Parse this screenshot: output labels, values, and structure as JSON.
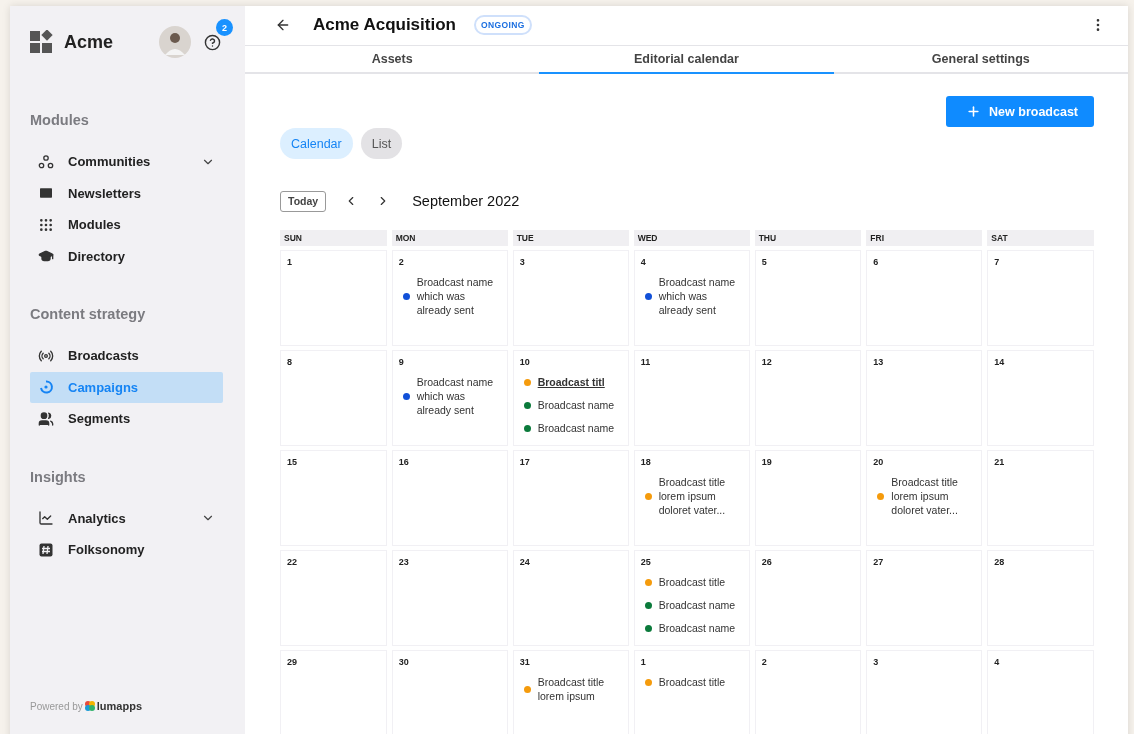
{
  "sidebar": {
    "brand": "Acme",
    "help_badge": "2",
    "sections": [
      {
        "title": "Modules",
        "items": [
          {
            "label": "Communities",
            "expandable": true,
            "selected": false
          },
          {
            "label": "Newsletters",
            "expandable": false,
            "selected": false
          },
          {
            "label": "Modules",
            "expandable": false,
            "selected": false
          },
          {
            "label": "Directory",
            "expandable": false,
            "selected": false
          }
        ]
      },
      {
        "title": "Content strategy",
        "items": [
          {
            "label": "Broadcasts",
            "expandable": false,
            "selected": false
          },
          {
            "label": "Campaigns",
            "expandable": false,
            "selected": true
          },
          {
            "label": "Segments",
            "expandable": false,
            "selected": false
          }
        ]
      },
      {
        "title": "Insights",
        "items": [
          {
            "label": "Analytics",
            "expandable": true,
            "selected": false
          },
          {
            "label": "Folksonomy",
            "expandable": false,
            "selected": false
          }
        ]
      }
    ],
    "powered_by": "Powered by",
    "powered_logo": "lumapps"
  },
  "header": {
    "title": "Acme Acquisition",
    "status": "ONGOING"
  },
  "tabs": [
    {
      "label": "Assets",
      "selected": false
    },
    {
      "label": "Editorial calendar",
      "selected": true
    },
    {
      "label": "General settings",
      "selected": false
    }
  ],
  "new_button": "New broadcast",
  "views": [
    {
      "label": "Calendar",
      "selected": true
    },
    {
      "label": "List",
      "selected": false
    }
  ],
  "calendar": {
    "today": "Today",
    "month": "September 2022",
    "weekdays": [
      "SUN",
      "MON",
      "TUE",
      "WED",
      "THU",
      "FRI",
      "SAT"
    ],
    "weeks": [
      [
        {
          "day": "1"
        },
        {
          "day": "2",
          "events": [
            {
              "text": "Broadcast name which was already sent",
              "color": "#1150d8",
              "kind": "plain"
            }
          ]
        },
        {
          "day": "3"
        },
        {
          "day": "4",
          "events": [
            {
              "text": "Broadcast name which was already sent",
              "color": "#1150d8",
              "kind": "plain"
            }
          ]
        },
        {
          "day": "5"
        },
        {
          "day": "6"
        },
        {
          "day": "7"
        }
      ],
      [
        {
          "day": "8"
        },
        {
          "day": "9",
          "events": [
            {
              "text": "Broadcast name which was already sent",
              "color": "#1150d8",
              "kind": "plain"
            }
          ]
        },
        {
          "day": "10",
          "events": [
            {
              "text": "Broadcast titl",
              "color": "#f59b0c",
              "kind": "link"
            },
            {
              "text": "Broadcast name",
              "color": "#0b7a3b",
              "kind": "plain"
            },
            {
              "text": "Broadcast name",
              "color": "#0b7a3b",
              "kind": "plain"
            }
          ]
        },
        {
          "day": "11"
        },
        {
          "day": "12"
        },
        {
          "day": "13"
        },
        {
          "day": "14"
        }
      ],
      [
        {
          "day": "15"
        },
        {
          "day": "16"
        },
        {
          "day": "17"
        },
        {
          "day": "18",
          "events": [
            {
              "text": "Broadcast title lorem ipsum doloret vater...",
              "color": "#f59b0c",
              "kind": "plain"
            }
          ]
        },
        {
          "day": "19"
        },
        {
          "day": "20",
          "events": [
            {
              "text": "Broadcast title lorem ipsum doloret vater...",
              "color": "#f59b0c",
              "kind": "plain"
            }
          ]
        },
        {
          "day": "21"
        }
      ],
      [
        {
          "day": "22"
        },
        {
          "day": "23"
        },
        {
          "day": "24"
        },
        {
          "day": "25",
          "events": [
            {
              "text": "Broadcast title",
              "color": "#f59b0c",
              "kind": "plain"
            },
            {
              "text": "Broadcast name",
              "color": "#0b7a3b",
              "kind": "plain"
            },
            {
              "text": "Broadcast name",
              "color": "#0b7a3b",
              "kind": "plain"
            }
          ]
        },
        {
          "day": "26"
        },
        {
          "day": "27"
        },
        {
          "day": "28"
        }
      ],
      [
        {
          "day": "29"
        },
        {
          "day": "30"
        },
        {
          "day": "31",
          "events": [
            {
              "text": "Broadcast title lorem ipsum",
              "color": "#f59b0c",
              "kind": "plain"
            }
          ]
        },
        {
          "day": "1",
          "events": [
            {
              "text": "Broadcast title",
              "color": "#f59b0c",
              "kind": "plain"
            }
          ]
        },
        {
          "day": "2"
        },
        {
          "day": "3"
        },
        {
          "day": "4"
        }
      ]
    ]
  }
}
